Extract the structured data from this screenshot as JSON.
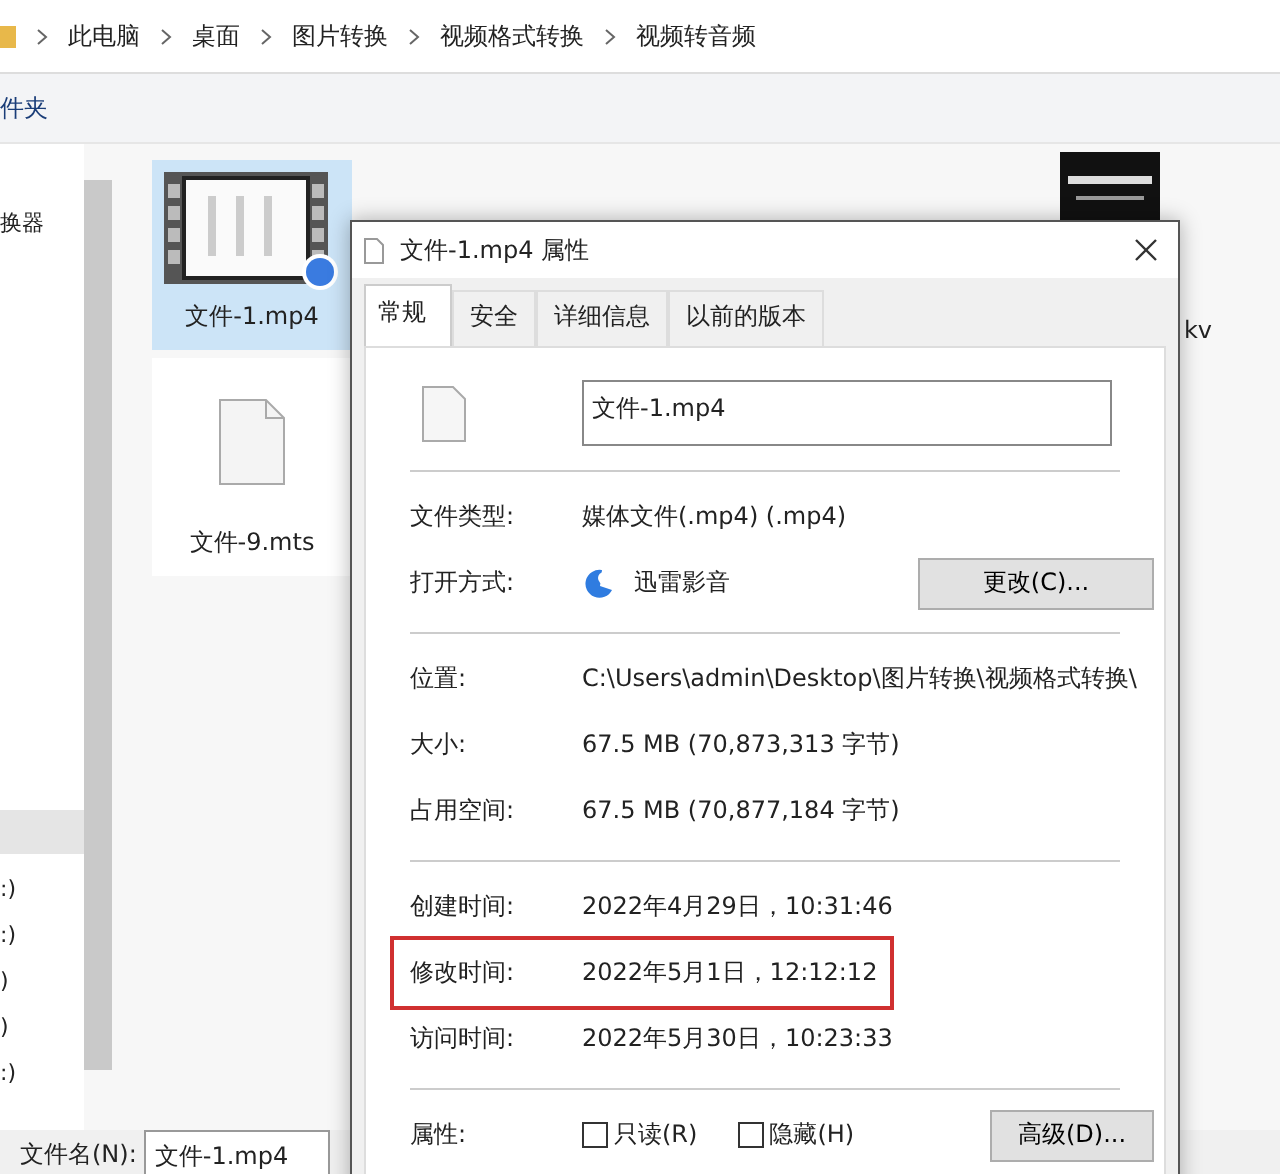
{
  "breadcrumb": [
    "此电脑",
    "桌面",
    "图片转换",
    "视频格式转换",
    "视频转音频"
  ],
  "toolbar_text": "件夹",
  "nav_items": [
    {
      "label": "换器"
    },
    {
      "label": ":)"
    },
    {
      "label": ":)"
    },
    {
      "label": ")"
    },
    {
      "label": ")"
    },
    {
      "label": ":)"
    }
  ],
  "files": [
    {
      "name": "文件-1.mp4",
      "kind": "video",
      "selected": true
    },
    {
      "name": "文件-9.mts",
      "kind": "blank",
      "selected": false
    },
    {
      "name": "kv",
      "kind": "picture",
      "selected": false
    }
  ],
  "bottom": {
    "label": "文件名(N):",
    "value": "文件-1.mp4"
  },
  "dialog": {
    "title": "文件-1.mp4 属性",
    "tabs": [
      {
        "label": "常规",
        "selected": true
      },
      {
        "label": "安全",
        "selected": false
      },
      {
        "label": "详细信息",
        "selected": false
      },
      {
        "label": "以前的版本",
        "selected": false
      }
    ],
    "name_field": "文件-1.mp4",
    "sections": [
      [
        {
          "label": "文件类型:",
          "value": "媒体文件(.mp4) (.mp4)",
          "kind": "text",
          "highlighted": false
        },
        {
          "label": "打开方式:",
          "value": "迅雷影音",
          "kind": "app",
          "button": "更改(C)...",
          "highlighted": false
        }
      ],
      [
        {
          "label": "位置:",
          "value": "C:\\Users\\admin\\Desktop\\图片转换\\视频格式转换\\",
          "kind": "text",
          "highlighted": false
        },
        {
          "label": "大小:",
          "value": "67.5 MB (70,873,313 字节)",
          "kind": "text",
          "highlighted": false
        },
        {
          "label": "占用空间:",
          "value": "67.5 MB (70,877,184 字节)",
          "kind": "text",
          "highlighted": false
        }
      ],
      [
        {
          "label": "创建时间:",
          "value": "2022年4月29日，10:31:46",
          "kind": "text",
          "highlighted": false
        },
        {
          "label": "修改时间:",
          "value": "2022年5月1日，12:12:12",
          "kind": "text",
          "highlighted": true
        },
        {
          "label": "访问时间:",
          "value": "2022年5月30日，10:23:33",
          "kind": "text",
          "highlighted": false
        }
      ],
      [
        {
          "label": "属性:",
          "kind": "attributes",
          "checkboxes": [
            {
              "label": "只读(R)",
              "checked": false
            },
            {
              "label": "隐藏(H)",
              "checked": false
            }
          ],
          "button": "高级(D)...",
          "highlighted": false
        }
      ]
    ]
  }
}
